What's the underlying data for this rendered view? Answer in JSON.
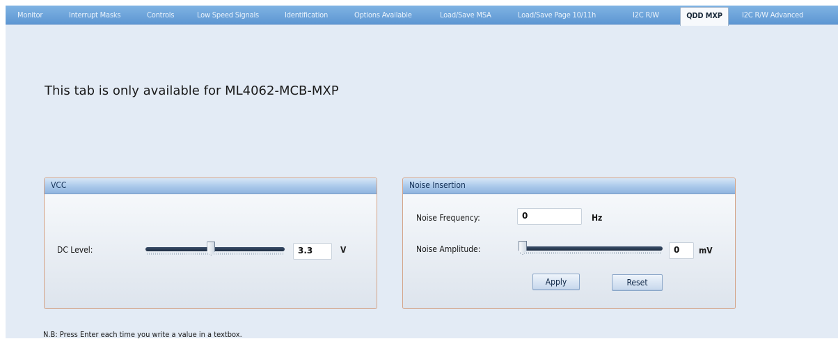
{
  "tabs": [
    {
      "label": "Monitor",
      "active": false
    },
    {
      "label": "Interrupt Masks",
      "active": false
    },
    {
      "label": "Controls",
      "active": false
    },
    {
      "label": "Low Speed Signals",
      "active": false
    },
    {
      "label": "Identification",
      "active": false
    },
    {
      "label": "Options Available",
      "active": false
    },
    {
      "label": "Load/Save MSA",
      "active": false
    },
    {
      "label": "Load/Save Page 10/11h",
      "active": false
    },
    {
      "label": "I2C R/W",
      "active": false
    },
    {
      "label": "QDD MXP",
      "active": true
    },
    {
      "label": "I2C R/W Advanced",
      "active": false
    }
  ],
  "notice": "This tab is only available for ML4062-MCB-MXP",
  "vcc": {
    "title": "VCC",
    "dc_level_label": "DC Level:",
    "dc_level_value": "3.3",
    "dc_level_unit": "V",
    "slider_fraction": 0.47
  },
  "noise": {
    "title": "Noise Insertion",
    "frequency_label": "Noise Frequency:",
    "frequency_value": "0",
    "frequency_unit": "Hz",
    "amplitude_label": "Noise Amplitude:",
    "amplitude_value": "0",
    "amplitude_unit": "mV",
    "amplitude_slider_fraction": 0.0,
    "apply_label": "Apply",
    "reset_label": "Reset"
  },
  "footnote": "N.B: Press Enter each time you write a value in a textbox."
}
